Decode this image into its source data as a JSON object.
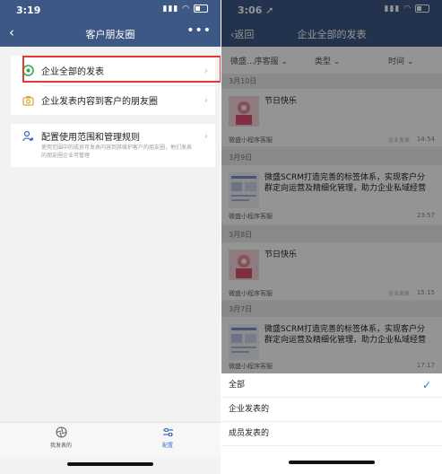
{
  "left_screen": {
    "status_time": "3:19",
    "nav_title": "客户朋友圈",
    "menu": [
      {
        "label": "企业全部的发表"
      },
      {
        "label": "企业发表内容到客户的朋友圈"
      },
      {
        "label": "配置使用范围和管理规则",
        "description": "使用范围中的成员可发表内容到其维护客户的朋友圈，他们发表的朋友圈企业可管理"
      }
    ],
    "tabs": [
      {
        "label": "我发表的"
      },
      {
        "label": "配置"
      }
    ],
    "colors": {
      "nav": "#3d5885",
      "highlight": "#e53935",
      "active_tab": "#3d6fc4"
    }
  },
  "right_screen": {
    "status_time": "3:06",
    "nav_back": "返回",
    "nav_title": "企业全部的发表",
    "filters": [
      "微盛...序客服",
      "类型",
      "时间"
    ],
    "groups": [
      {
        "date": "3月10日",
        "text": "节日快乐",
        "author": "微盛小程序客服",
        "tag": "企业发表",
        "time": "14:54"
      },
      {
        "date": "3月9日",
        "text": "微盛SCRM打造完善的标签体系，实现客户分群定向运营及精细化管理，助力企业私域经营",
        "author": "微盛小程序客服",
        "tag": "",
        "time": "23:57"
      },
      {
        "date": "3月8日",
        "text": "节日快乐",
        "author": "微盛小程序客服",
        "tag": "企业发表",
        "time": "15:15"
      },
      {
        "date": "3月7日",
        "text": "微盛SCRM打造完善的标签体系，实现客户分群定向运营及精细化管理，助力企业私域经营",
        "author": "微盛小程序客服",
        "tag": "",
        "time": "17:17"
      }
    ],
    "sheet_options": [
      "全部",
      "企业发表的",
      "成员发表的"
    ],
    "selected_option": "全部"
  }
}
